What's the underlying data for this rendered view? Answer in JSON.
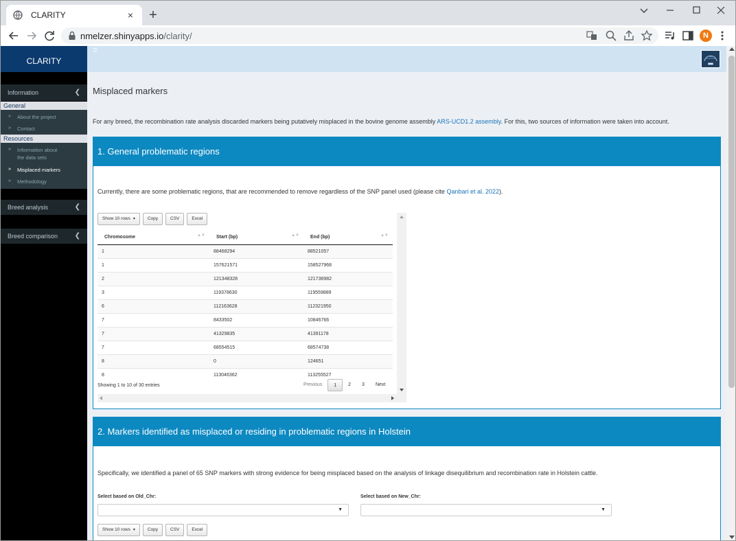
{
  "browser": {
    "tab_title": "CLARITY",
    "tab_close": "×",
    "new_tab": "+",
    "url_host": "nmelzer.shinyapps.io",
    "url_path": "/clarity/",
    "avatar_letter": "N",
    "icons": [
      "globe-icon",
      "back-icon",
      "forward-icon",
      "reload-icon",
      "lock-icon",
      "translate-icon",
      "zoom-icon",
      "share-icon",
      "bookmark-star-icon",
      "playlist-icon",
      "side-panel-icon",
      "menu-icon"
    ]
  },
  "sidebar": {
    "brand": "CLARITY",
    "information_label": "Information",
    "general_header": "General",
    "general_items": [
      "About the project",
      "Contact"
    ],
    "resources_header": "Resources",
    "resources_items": [
      "Information about",
      "the data sets",
      "Misplaced markers",
      "Methodology"
    ],
    "breed_analysis_label": "Breed analysis",
    "breed_comparison_label": "Breed comparison",
    "active_item": "Misplaced markers"
  },
  "header": {
    "hamburger": "☰"
  },
  "main": {
    "page_title": "Misplaced markers",
    "intro_before_link": "For any breed, the recombination rate analysis discarded markers being putatively misplaced in the bovine genome assembly ",
    "intro_link": "ARS-UCD1.2 assembly",
    "intro_after_link": ". For this, two sources of information were taken into account.",
    "box1": {
      "title": "1. General problematic regions",
      "text_before_link": "Currently, there are some problematic regions, that are recommended to remove regardless of the SNP panel used (please cite ",
      "text_link": "Qanbari et al. 2022",
      "text_after_link": ").",
      "buttons": {
        "show_rows": "Show 10 rows",
        "copy": "Copy",
        "csv": "CSV",
        "excel": "Excel"
      },
      "table": {
        "headers": [
          "Chromosome",
          "Start (bp)",
          "End (bp)"
        ],
        "rows": [
          [
            "1",
            "88468294",
            "88521057"
          ],
          [
            "1",
            "157621571",
            "158527968"
          ],
          [
            "2",
            "121348328",
            "121736982"
          ],
          [
            "3",
            "119378630",
            "119559889"
          ],
          [
            "6",
            "112163628",
            "112321950"
          ],
          [
            "7",
            "8433502",
            "10846766"
          ],
          [
            "7",
            "41329835",
            "41391178"
          ],
          [
            "7",
            "68554515",
            "68574738"
          ],
          [
            "8",
            "0",
            "124651"
          ],
          [
            "8",
            "113046362",
            "113255527"
          ]
        ]
      },
      "info": "Showing 1 to 10 of 30 entries",
      "pager": {
        "previous": "Previous",
        "pages": [
          "1",
          "2",
          "3"
        ],
        "next": "Next",
        "current": "1"
      }
    },
    "box2": {
      "title": "2. Markers identified as misplaced or residing in problematic regions in Holstein",
      "text": "Specifically, we identified a panel of 65 SNP markers with strong evidence for being misplaced based on the analysis of linkage disequilibrium and recombination rate in Holstein cattle.",
      "select_old_label": "Select based on Old_Chr:",
      "select_new_label": "Select based on New_Chr:",
      "buttons": {
        "show_rows": "Show 10 rows",
        "copy": "Copy",
        "csv": "CSV",
        "excel": "Excel"
      }
    }
  },
  "colors": {
    "box_header": "#0d89c1",
    "sidebar_bg": "#000000",
    "brand_bg": "#0b3a6e",
    "header_bg": "#cfe3f3",
    "link": "#1a73b8",
    "avatar": "#ef7a12"
  }
}
